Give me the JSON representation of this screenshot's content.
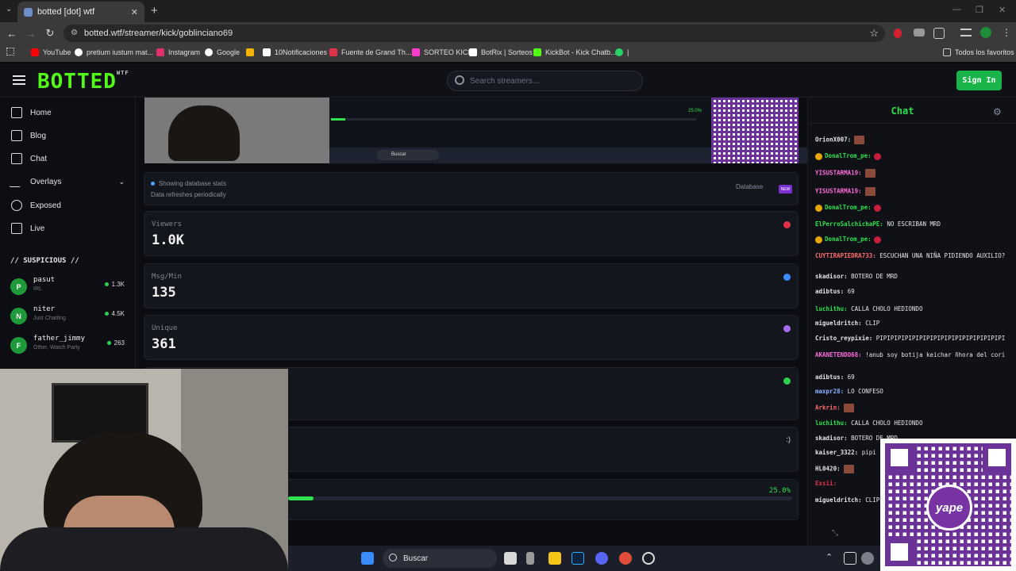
{
  "browser": {
    "tab_title": "botted [dot] wtf",
    "url": "botted.wtf/streamer/kick/goblinciano69",
    "bookmarks": [
      {
        "label": "YouTube",
        "color": "#ff0000"
      },
      {
        "label": "pretium iustum mat...",
        "color": "#ffffff"
      },
      {
        "label": "Instagram",
        "color": "#e1306c"
      },
      {
        "label": "Google",
        "color": "#ffffff"
      },
      {
        "label": "",
        "color": "#f5b400"
      },
      {
        "label": "10Notificaciones",
        "color": "#ffffff"
      },
      {
        "label": "Fuente de Grand Th...",
        "color": "#e0314b"
      },
      {
        "label": "SORTEO KICK",
        "color": "#ff3bd0"
      },
      {
        "label": "BotRix | Sorteos",
        "color": "#ffffff"
      },
      {
        "label": "KickBot - Kick Chatb...",
        "color": "#53fc18"
      },
      {
        "label": "|",
        "color": "#25d366"
      }
    ],
    "all_bookmarks": "Todos los favoritos"
  },
  "site": {
    "logo": "BOTTED",
    "logo_sup": "WTF",
    "search_placeholder": "Search streamers...",
    "signin": "Sign In"
  },
  "sidebar": {
    "nav": [
      {
        "label": "Home",
        "icon": "home-icon"
      },
      {
        "label": "Blog",
        "icon": "document-icon"
      },
      {
        "label": "Chat",
        "icon": "chat-icon"
      },
      {
        "label": "Overlays",
        "icon": "activity-icon"
      },
      {
        "label": "Exposed",
        "icon": "eye-icon"
      },
      {
        "label": "Live",
        "icon": "tv-icon"
      }
    ],
    "section": "// SUSPICIOUS //",
    "streamers": [
      {
        "initial": "P",
        "name": "pasut",
        "category": "IRL",
        "viewers": "1.3K"
      },
      {
        "initial": "N",
        "name": "niter",
        "category": "Just Chatting",
        "viewers": "4.5K"
      },
      {
        "initial": "F",
        "name": "father_jimmy",
        "category": "Other, Watch Party",
        "viewers": "263"
      }
    ]
  },
  "main": {
    "info_title": "Showing database stats",
    "info_sub": "Data refreshes periodically",
    "database_label": "Database",
    "new_badge": "NEW",
    "stats": [
      {
        "label": "Viewers",
        "value": "1.0K",
        "icon_color": "#e0314b"
      },
      {
        "label": "Msg/Min",
        "value": "135",
        "icon_color": "#3b8cff"
      },
      {
        "label": "Unique",
        "value": "361",
        "icon_color": "#a56cf0"
      }
    ],
    "smiley": ":)",
    "progress_label": "25.0%",
    "progress_value": 0.05
  },
  "embed": {
    "taskbar_search": "Buscar",
    "progress_label": "25.0%"
  },
  "chat": {
    "title": "Chat",
    "messages": [
      {
        "user": "OrionX007:",
        "text": "",
        "color": "#e6e6e6",
        "emote": true
      },
      {
        "user": "DonalTrom_pe:",
        "text": "",
        "color": "#2ee14d",
        "badge": true,
        "rbadge": true
      },
      {
        "user": "YISUSTARMA19:",
        "text": "",
        "color": "#ff6bd8",
        "emote": true
      },
      {
        "user": "YISUSTARMA19:",
        "text": "",
        "color": "#ff6bd8",
        "emote": true
      },
      {
        "user": "DonalTrom_pe:",
        "text": "",
        "color": "#2ee14d",
        "badge": true,
        "rbadge": true
      },
      {
        "user": "ElPerroSalchichaPE:",
        "text": "NO ESCRIBAN MRD",
        "color": "#2ee14d"
      },
      {
        "user": "DonalTrom_pe:",
        "text": "",
        "color": "#2ee14d",
        "badge": true,
        "rbadge": true
      },
      {
        "user": "CUYTIRAPIEDRA733:",
        "text": "ESCUCHAN UNA NIÑA PIDIENDO AUXILIO?",
        "color": "#ff6b6b"
      },
      {
        "user": "skadisor:",
        "text": "BOTERO DE MRD",
        "color": "#e6e6e6"
      },
      {
        "user": "adibtus:",
        "text": "69",
        "color": "#e6e6e6"
      },
      {
        "user": "luchithu:",
        "text": "CALLA CHOLO HEDIONDO",
        "color": "#2ee14d"
      },
      {
        "user": "migueldritch:",
        "text": "CLIP",
        "color": "#e6e6e6"
      },
      {
        "user": "Cristo_reypixie:",
        "text": "PIPIPIPIPIPIPIPIPIPIPIPIPIPIPIPIPIPI",
        "color": "#e6e6e6"
      },
      {
        "user": "AKANETENDO68:",
        "text": "!anub soy botija keichar ñhora del cori",
        "color": "#ff6bd8"
      },
      {
        "user": "adibtus:",
        "text": "69",
        "color": "#e6e6e6"
      },
      {
        "user": "maxpr28:",
        "text": "LO CONFESO",
        "color": "#8ab4ff"
      },
      {
        "user": "Arkrin:",
        "text": "",
        "color": "#ff6b6b",
        "emote": true
      },
      {
        "user": "luchithu:",
        "text": "CALLA CHOLO HEDIONDO",
        "color": "#2ee14d"
      },
      {
        "user": "skadisor:",
        "text": "BOTERO DE MRD",
        "color": "#e6e6e6"
      },
      {
        "user": "kaiser_3322:",
        "text": "pipi",
        "color": "#e6e6e6"
      },
      {
        "user": "HL0420:",
        "text": "",
        "color": "#e6e6e6",
        "emote": true
      },
      {
        "user": "Exsii:",
        "text": "",
        "color": "#e0314b"
      },
      {
        "user": "migueldritch:",
        "text": "CLIP",
        "color": "#e6e6e6"
      }
    ]
  },
  "overlay": {
    "qr_brand": "yape"
  },
  "taskbar": {
    "search": "Buscar"
  }
}
